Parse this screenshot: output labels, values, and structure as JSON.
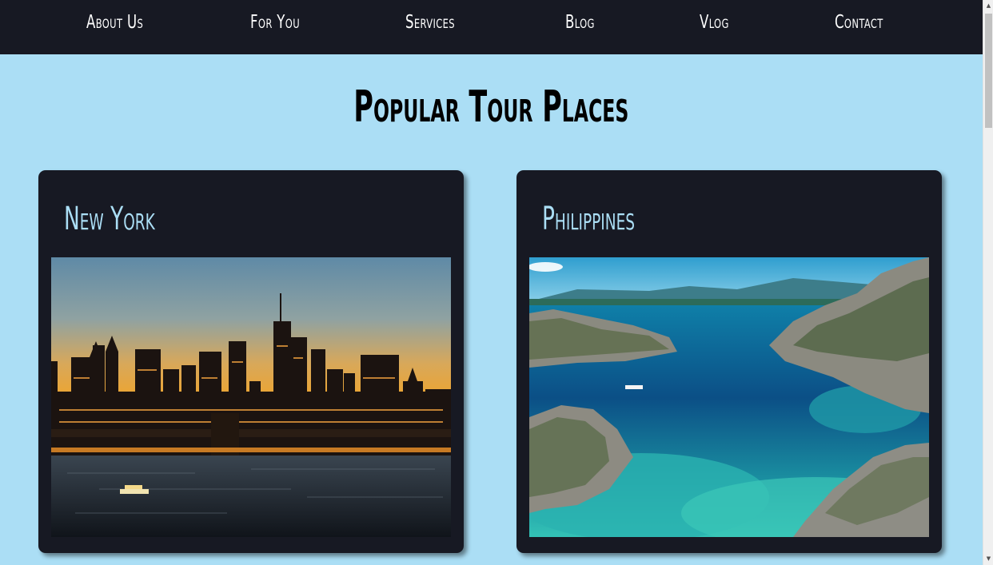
{
  "nav": {
    "items": [
      {
        "label": "About Us"
      },
      {
        "label": "For You"
      },
      {
        "label": "Services"
      },
      {
        "label": "Blog"
      },
      {
        "label": "Vlog"
      },
      {
        "label": "Contact"
      }
    ]
  },
  "main": {
    "title": "Popular Tour Places",
    "cards": [
      {
        "title": "New York",
        "image_icon": "new-york-skyline-photo"
      },
      {
        "title": "Philippines",
        "image_icon": "philippines-lagoon-photo"
      }
    ]
  },
  "colors": {
    "nav_bg": "#171923",
    "page_bg": "#abdef5",
    "card_bg": "#171923",
    "card_title": "#abdef5"
  },
  "scrollbar": {
    "up_icon": "arrow-up-icon",
    "down_icon": "arrow-down-icon"
  }
}
